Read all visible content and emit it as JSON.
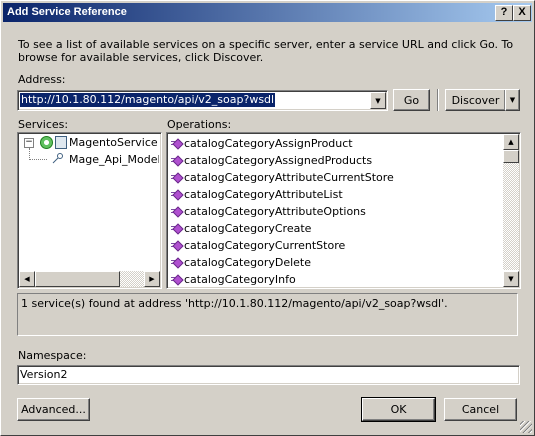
{
  "window": {
    "title": "Add Service Reference",
    "help_glyph": "?",
    "close_glyph": "X"
  },
  "instructions": "To see a list of available services on a specific server, enter a service URL and click Go. To browse for available services, click Discover.",
  "address": {
    "label": "Address:",
    "value": "http://10.1.80.112/magento/api/v2_soap?wsdl",
    "go_label": "Go",
    "discover_label": "Discover"
  },
  "services": {
    "label": "Services:",
    "items": [
      {
        "label": "MagentoService",
        "expander": "−",
        "icon": "service-icon"
      },
      {
        "label": "Mage_Api_Model",
        "icon": "interface-icon"
      }
    ]
  },
  "operations": {
    "label": "Operations:",
    "icon": "method-icon",
    "items": [
      "catalogCategoryAssignProduct",
      "catalogCategoryAssignedProducts",
      "catalogCategoryAttributeCurrentStore",
      "catalogCategoryAttributeList",
      "catalogCategoryAttributeOptions",
      "catalogCategoryCreate",
      "catalogCategoryCurrentStore",
      "catalogCategoryDelete",
      "catalogCategoryInfo"
    ]
  },
  "status": "1 service(s) found at address 'http://10.1.80.112/magento/api/v2_soap?wsdl'.",
  "namespace": {
    "label": "Namespace:",
    "value": "Version2"
  },
  "buttons": {
    "advanced": "Advanced...",
    "ok": "OK",
    "cancel": "Cancel"
  }
}
